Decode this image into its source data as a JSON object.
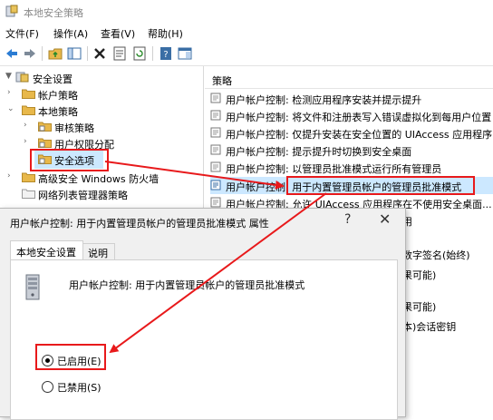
{
  "window": {
    "title": "本地安全策略"
  },
  "menu": [
    {
      "label": "文件(F)"
    },
    {
      "label": "操作(A)"
    },
    {
      "label": "查看(V)"
    },
    {
      "label": "帮助(H)"
    }
  ],
  "toolbar": {
    "icons": [
      "back-icon",
      "forward-icon",
      "up-folder-icon",
      "show-hide-tree-icon",
      "delete-icon",
      "properties-icon",
      "refresh-icon",
      "export-list-icon",
      "help-icon",
      "help-topics-icon"
    ]
  },
  "tree": [
    {
      "label": "安全设置",
      "expanded": true
    },
    {
      "label": "帐户策略",
      "expanded": false
    },
    {
      "label": "本地策略",
      "expanded": true
    },
    {
      "label": "审核策略",
      "expanded": false
    },
    {
      "label": "用户权限分配",
      "expanded": false
    },
    {
      "label": "安全选项",
      "selected": true
    },
    {
      "label": "高级安全 Windows 防火墙",
      "expanded": false
    },
    {
      "label": "网络列表管理器策略",
      "expanded": false
    }
  ],
  "list": {
    "header": "策略",
    "rows": [
      "用户帐户控制: 检测应用程序安装并提示提升",
      "用户帐户控制: 将文件和注册表写入错误虚拟化到每用户位置",
      "用户帐户控制: 仅提升安装在安全位置的 UIAccess 应用程序",
      "用户帐户控制: 提示提升时切换到安全桌面",
      "用户帐户控制: 以管理员批准模式运行所有管理员",
      "用户帐户控制: 用于内置管理员帐户的管理员批准模式",
      "用户帐户控制: 允许 UIAccess 应用程序在不使用安全桌面..."
    ],
    "selected_index": 5,
    "right_fragments": [
      "用",
      "数字签名(始终)",
      "果可能)",
      "果可能)",
      "本)会话密钥"
    ]
  },
  "dialog": {
    "title": "用户帐户控制: 用于内置管理员帐户的管理员批准模式 属性",
    "help_label": "?",
    "close_label": "✕",
    "tabs": [
      "本地安全设置",
      "说明"
    ],
    "policy_name": "用户帐户控制: 用于内置管理员帐户的管理员批准模式",
    "options": [
      {
        "label": "已启用(E)",
        "checked": true
      },
      {
        "label": "已禁用(S)",
        "checked": false
      }
    ]
  },
  "colors": {
    "annotation": "#e8191b",
    "selection": "#cce8ff",
    "folder": "#e8b84a",
    "dialog_bg": "#f0f0f0"
  }
}
